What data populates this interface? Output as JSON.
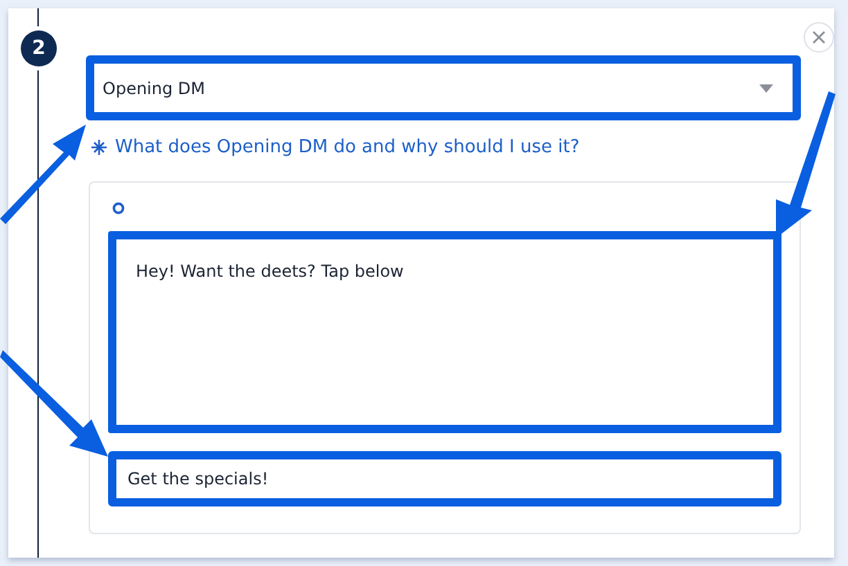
{
  "step": {
    "number": "2"
  },
  "dropdown": {
    "value": "Opening DM"
  },
  "help_link": "What does Opening DM do and why should I use it?",
  "message": {
    "text": "Hey! Want the deets? Tap below"
  },
  "button_field": {
    "value": "Get the specials!"
  }
}
